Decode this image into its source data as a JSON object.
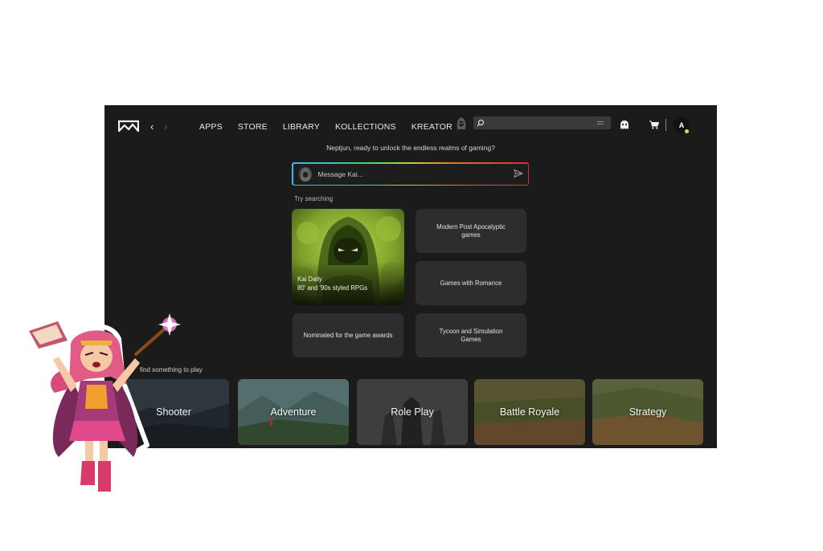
{
  "nav": {
    "back_icon": "chevron-left-icon",
    "forward_icon": "chevron-right-icon",
    "items": [
      "APPS",
      "STORE",
      "LIBRARY",
      "KOLLECTIONS",
      "KREATOR"
    ]
  },
  "search": {
    "value": "",
    "placeholder": ""
  },
  "user": {
    "avatar_letter": "A",
    "status_color": "#c9e64a"
  },
  "greeting": "Neptjun, ready to unlock the endless realms of gaming?",
  "chat": {
    "placeholder": "Message Kai..."
  },
  "try_searching": {
    "label": "Try searching",
    "featured": {
      "line1": "Kai Daily",
      "line2": "80' and '90s styled RPGs"
    },
    "suggestions": [
      "Modern Post Apocalyptic games",
      "Games with Romance",
      "Nominated for the game awards",
      "Tycoon and Simulation Games"
    ]
  },
  "find_label": "find something to play",
  "genres": [
    "Shooter",
    "Adventure",
    "Role Play",
    "Battle Royale",
    "Strategy"
  ],
  "colors": {
    "app_bg": "#1b1b1b",
    "tile_bg": "#2d2d2d",
    "accent_green": "#c9e64a"
  }
}
